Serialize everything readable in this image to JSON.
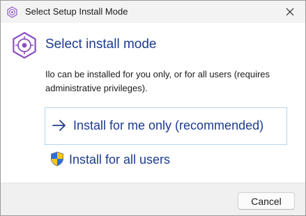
{
  "window": {
    "title": "Select Setup Install Mode"
  },
  "main": {
    "heading": "Select install mode",
    "description": "Ilo can be installed for you only, or for all users (requires administrative privileges)."
  },
  "options": {
    "current_user": {
      "label": "Install for me only (recommended)",
      "icon": "arrow-right-icon"
    },
    "all_users": {
      "label": "Install for all users",
      "icon": "uac-shield-icon"
    }
  },
  "footer": {
    "cancel_label": "Cancel"
  },
  "colors": {
    "accent": "#1c3b8f",
    "app_icon": "#8a4fc4",
    "option_border": "#b8d4ea"
  }
}
